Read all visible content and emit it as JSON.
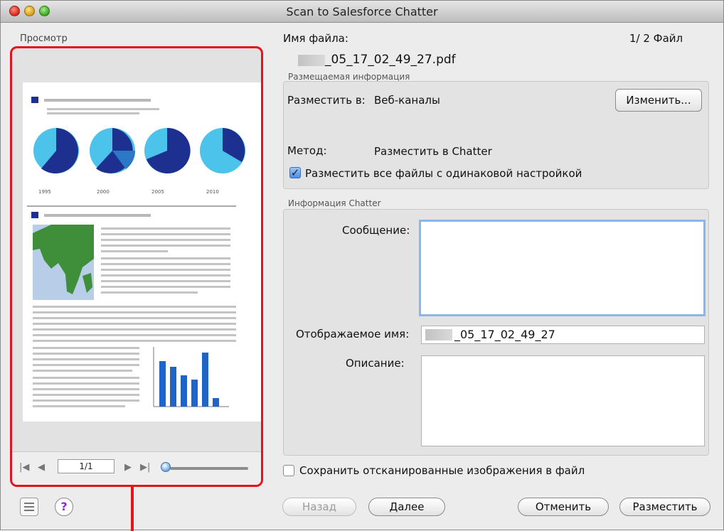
{
  "window": {
    "title": "Scan to Salesforce Chatter"
  },
  "preview": {
    "label": "Просмотр",
    "page_field": "1/1",
    "years": [
      "1995",
      "2000",
      "2005",
      "2010"
    ]
  },
  "file": {
    "name_label": "Имя файла:",
    "counter": "1/  2 Файл",
    "filename": "_05_17_02_49_27.pdf"
  },
  "post_info": {
    "section_label": "Размещаемая информация",
    "post_to_label": "Разместить в:",
    "post_to_value": "Веб-каналы",
    "change_button": "Изменить...",
    "method_label": "Метод:",
    "method_value": "Разместить в Chatter",
    "same_setting_checkbox": "Разместить все файлы с одинаковой настройкой"
  },
  "chatter_info": {
    "section_label": "Информация Chatter",
    "message_label": "Сообщение:",
    "display_name_label": "Отображаемое имя:",
    "display_name_value": "_05_17_02_49_27",
    "description_label": "Описание:"
  },
  "save_checkbox": "Сохранить отсканированные изображения в файл",
  "buttons": {
    "back": "Назад",
    "next": "Далее",
    "cancel": "Отменить",
    "post": "Разместить"
  },
  "colors": {
    "callout": "#e3141b",
    "pie_dark": "#1d2f8f",
    "pie_light": "#4cc3ea",
    "bar": "#1f64c8",
    "map_land": "#3f8f3a",
    "map_sea": "#b8cde8"
  }
}
